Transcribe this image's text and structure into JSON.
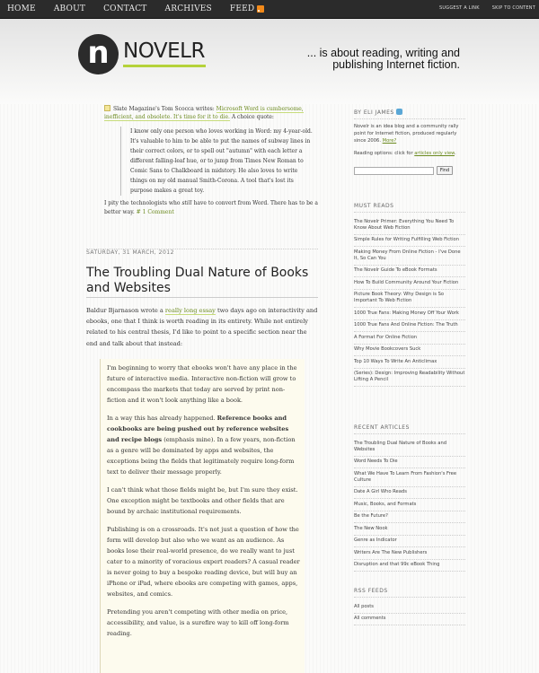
{
  "topnav": {
    "items": [
      "HOME",
      "ABOUT",
      "CONTACT",
      "ARCHIVES",
      "FEED"
    ],
    "right_links": [
      "SUGGEST A LINK",
      "SKIP TO CONTENT"
    ]
  },
  "header": {
    "logo_letter": "n",
    "logo_text": "NOVELR",
    "tagline": "... is about reading, writing and publishing Internet fiction."
  },
  "quote_post": {
    "intro_prefix": "Slate Magazine's Tom Scocca writes: ",
    "intro_link": "Microsoft Word is cumbersome, inefficient, and obsolete. It's time for it to die.",
    "intro_suffix": " A choice quote:",
    "quote": "I know only one person who loves working in Word: my 4-year-old. It's valuable to him to be able to put the names of subway lines in their correct colors, or to spell out \"autumn\" with each letter a different falling-leaf hue, or to jump from Times New Roman to Comic Sans to Chalkboard in midstory. He also loves to write things on my old manual Smith-Corona. A tool that's lost its purpose makes a great toy.",
    "after_a": "I pity the technologists who ",
    "after_em": "still",
    "after_b": " have to convert from Word. There has to be a better way. ",
    "comment_link": "# 1 Comment"
  },
  "post": {
    "date": "SATURDAY, 31 MARCH, 2012",
    "title": "The Troubling Dual Nature of Books and Websites",
    "intro_a": "Baldur Bjarnason wrote a ",
    "intro_link": "really long essay",
    "intro_b": " two days ago on interactivity and ebooks, one that I think is worth reading in its entirety. While not entirely related to his central thesis, I'd like to point to a specific section near the end and talk about that instead:",
    "quote_p1": "I'm beginning to worry that ebooks won't have any place in the future of interactive media. Interactive non-fiction will grow to encompass the markets that today are served by print non-fiction and it won't look anything like a book.",
    "quote_p2_a": "In a way this has already happened. ",
    "quote_p2_bold": "Reference books and cookbooks are being pushed out by reference websites and recipe blogs",
    "quote_p2_b": " (emphasis mine). In a few years, non-fiction as a genre will be dominated by apps and websites, the exceptions being the fields that legitimately require long-form text to deliver their message properly.",
    "quote_p3": "I can't think what those fields might be, but I'm sure they exist. One exception might be textbooks and other fields that are bound by archaic institutional requirements.",
    "quote_p4": "Publishing is on a crossroads. It's not just a question of how the form will develop but also who we want as an audience. As books lose their real-world presence, do we really want to just cater to a minority of voracious expert readers? A casual reader is never going to buy a bespoke reading device, but will buy an iPhone or iPad, where ebooks are competing with games, apps, websites, and comics.",
    "quote_p5": "Pretending you aren't competing with other media on price, accessibility, and value, is a surefire way to kill off long-form reading."
  },
  "sidebar": {
    "about_heading": "BY ELI JAMES",
    "about_text": "Novelr is an idea blog and a community rally point for Internet fiction, produced regularly since 2006. ",
    "about_more": "More?",
    "reading_text": "Reading options: click for ",
    "reading_link": "articles only view",
    "reading_end": ".",
    "search_placeholder": "",
    "find_label": "Find",
    "must_heading": "MUST READS",
    "must_reads": [
      "The Novelr Primer: Everything You Need To Know About Web Fiction",
      "Simple Rules for Writing Fulfilling Web Fiction",
      "Making Money From Online Fiction - I've Done It, So Can You",
      "The Novelr Guide To eBook Formats",
      "How To Build Community Around Your Fiction",
      "Picture Book Theory: Why Design is So Important To Web Fiction",
      "1000 True Fans: Making Money Off Your Work",
      "1000 True Fans And Online Fiction: The Truth",
      "A Format For Online Fiction",
      "Why Movie Bookcovers Suck",
      "Top 10 Ways To Write An Anticlimax",
      "(Series): Design: Improving Readability Without Lifting A Pencil"
    ],
    "recent_heading": "RECENT ARTICLES",
    "recent": [
      "The Troubling Dual Nature of Books and Websites",
      "Word Needs To Die",
      "What We Have To Learn From Fashion's Free Culture",
      "Date A Girl Who Reads",
      "Music, Books, and Formats",
      "Be the Future?",
      "The New Nook",
      "Genre as Indicator",
      "Writers Are The New Publishers",
      "Disruption and that 99c eBook Thing"
    ],
    "rss_heading": "RSS FEEDS",
    "rss": [
      "All posts",
      "All comments"
    ]
  },
  "colors": {
    "topbar": "#2b2b2b",
    "link_green": "#6b8a1f",
    "logo_accent": "#b5d23a",
    "quote_bg": "#fdfbee",
    "rss_orange": "#f28a1a"
  }
}
